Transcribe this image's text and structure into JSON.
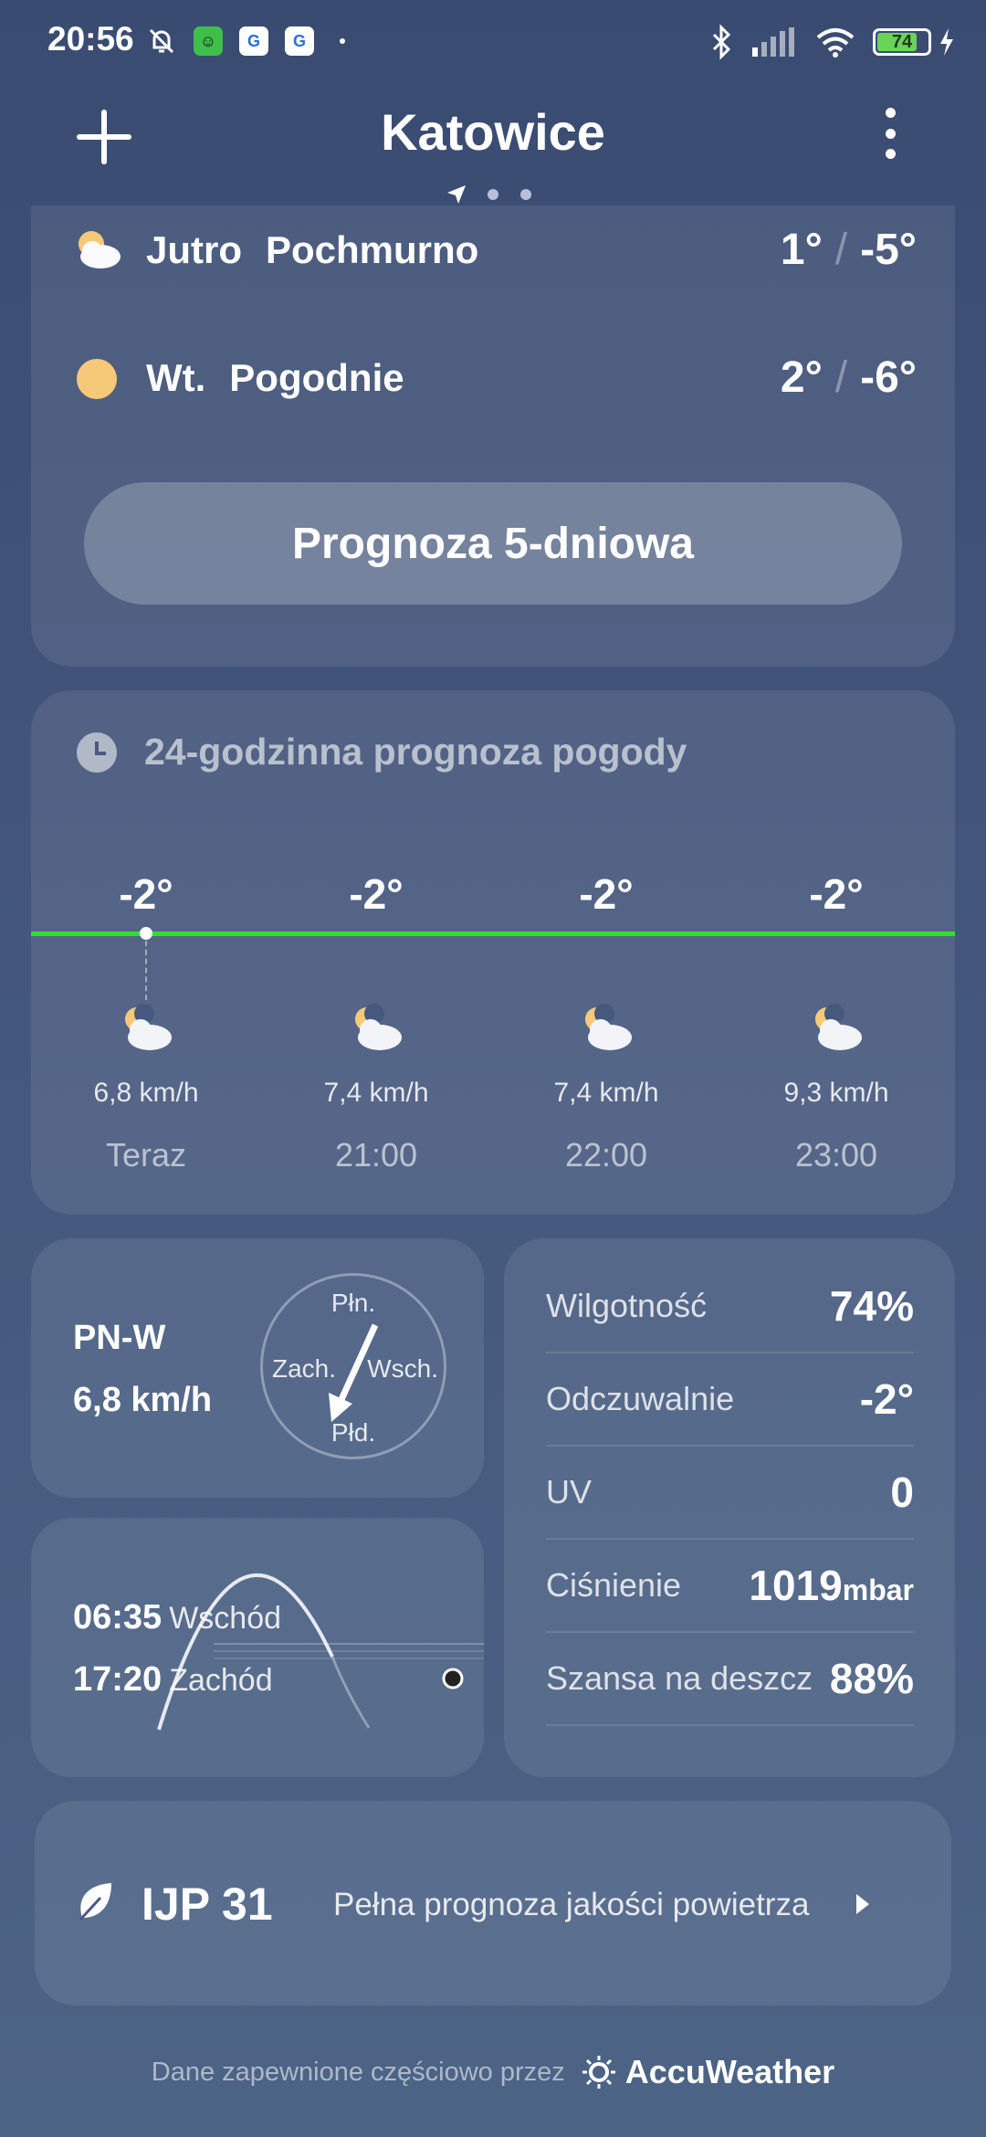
{
  "status_bar": {
    "time": "20:56",
    "battery": "74",
    "app_icons": [
      "mute-bell-icon",
      "frog-app-icon",
      "news-app-icon",
      "news-app-icon",
      "dot-icon"
    ],
    "right_icons": [
      "bluetooth-icon",
      "signal-icon",
      "wifi-icon",
      "battery-icon",
      "charging-icon"
    ]
  },
  "header": {
    "city": "Katowice"
  },
  "daily": [
    {
      "day": "Jutro",
      "condition": "Pochmurno",
      "high": "1°",
      "low": "-5°",
      "icon": "partly-cloudy-icon"
    },
    {
      "day": "Wt.",
      "condition": "Pogodnie",
      "high": "2°",
      "low": "-6°",
      "icon": "sun-icon"
    }
  ],
  "forecast_button": "Prognoza 5-dniowa",
  "hourly": {
    "title": "24-godzinna prognoza pogody",
    "items": [
      {
        "temp": "-2°",
        "wind": "6,8 km/h",
        "time": "Teraz",
        "icon": "night-cloudy-icon"
      },
      {
        "temp": "-2°",
        "wind": "7,4 km/h",
        "time": "21:00",
        "icon": "night-cloudy-icon"
      },
      {
        "temp": "-2°",
        "wind": "7,4 km/h",
        "time": "22:00",
        "icon": "night-cloudy-icon"
      },
      {
        "temp": "-2°",
        "wind": "9,3 km/h",
        "time": "23:00",
        "icon": "night-cloudy-icon"
      }
    ],
    "line_color": "#2ee02e"
  },
  "wind": {
    "direction": "PN-W",
    "speed": "6,8 km/h",
    "north": "Płn.",
    "south": "Płd.",
    "west": "Zach.",
    "east": "Wsch."
  },
  "sun": {
    "sunrise": "06:35",
    "sunrise_label": "Wschód",
    "sunset": "17:20",
    "sunset_label": "Zachód"
  },
  "details": [
    {
      "label": "Wilgotność",
      "value": "74%",
      "unit": ""
    },
    {
      "label": "Odczuwalnie",
      "value": "-2°",
      "unit": ""
    },
    {
      "label": "UV",
      "value": "0",
      "unit": ""
    },
    {
      "label": "Ciśnienie",
      "value": "1019",
      "unit": "mbar"
    },
    {
      "label": "Szansa na deszcz",
      "value": "88%",
      "unit": ""
    }
  ],
  "air": {
    "value": "IJP 31",
    "link": "Pełna prognoza jakości powietrza"
  },
  "footer": {
    "text": "Dane zapewnione częściowo przez",
    "brand": "AccuWeather"
  }
}
